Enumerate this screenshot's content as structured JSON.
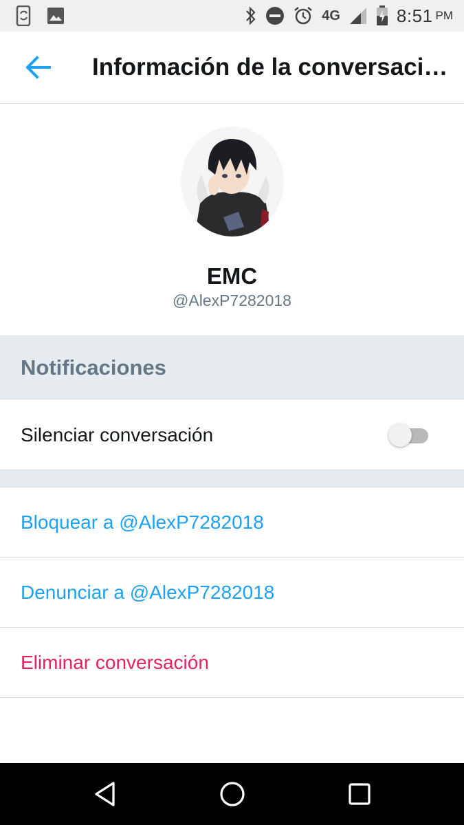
{
  "status_bar": {
    "left_icons": [
      "phone-sync-icon",
      "image-icon"
    ],
    "right_icons": [
      "bluetooth-icon",
      "do-not-disturb-icon",
      "alarm-icon",
      "signal-icon",
      "battery-icon"
    ],
    "network": "4G",
    "time": "8:51",
    "ampm": "PM"
  },
  "app_bar": {
    "back_icon": "arrow-left-icon",
    "title": "Información de la conversaci…"
  },
  "profile": {
    "name": "EMC",
    "handle": "@AlexP7282018"
  },
  "notifications": {
    "header": "Notificaciones",
    "mute_label": "Silenciar conversación",
    "mute_on": false
  },
  "actions": {
    "block": "Bloquear a @AlexP7282018",
    "report": "Denunciar a @AlexP7282018",
    "delete": "Eliminar conversación"
  },
  "nav_bar": {
    "icons": [
      "back-triangle-icon",
      "home-circle-icon",
      "recents-square-icon"
    ]
  },
  "colors": {
    "accent": "#1da1f2",
    "destructive": "#e0245e",
    "section_bg": "#e6ecf0",
    "muted_text": "#657786"
  }
}
